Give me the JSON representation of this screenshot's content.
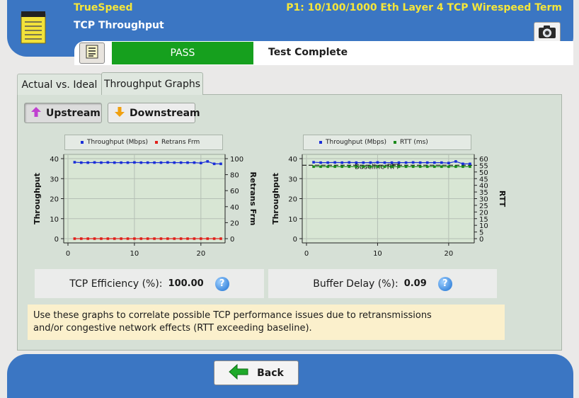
{
  "header": {
    "app_title": "TrueSpeed",
    "port_title": "P1: 10/100/1000 Eth Layer 4 TCP Wirespeed Term",
    "page_title": "TCP Throughput"
  },
  "status": {
    "result": "PASS",
    "result_color": "#16a01e",
    "message": "Test Complete"
  },
  "tabs": [
    {
      "label": "Actual vs. Ideal",
      "active": false
    },
    {
      "label": "Throughput Graphs",
      "active": true
    }
  ],
  "direction_buttons": {
    "upstream": "Upstream",
    "downstream": "Downstream",
    "selected": "upstream"
  },
  "metrics": {
    "tcp_efficiency_label": "TCP Efficiency (%):",
    "tcp_efficiency_value": "100.00",
    "buffer_delay_label": "Buffer Delay (%):",
    "buffer_delay_value": "0.09"
  },
  "note": "Use these graphs to correlate possible TCP performance issues due to retransmissions\nand/or congestive network effects (RTT exceeding baseline).",
  "footer": {
    "back_label": "Back"
  },
  "icons": {
    "app": "notepad-icon",
    "camera": "camera-icon",
    "report": "report-icon",
    "up": "arrow-up-icon",
    "down": "arrow-down-icon",
    "help": "help-icon",
    "back": "arrow-left-icon"
  },
  "colors": {
    "brand_blue": "#3b76c3",
    "header_yellow": "#f5e63a",
    "throughput": "#1a2fd8",
    "retrans": "#e0201a",
    "rtt": "#1a8a1a",
    "panel": "#d6e0d6",
    "note_bg": "#fbf0cc"
  },
  "chart_data": [
    {
      "type": "line",
      "legend": [
        "Throughput (Mbps)",
        "Retrans Frm"
      ],
      "ylabel": "Throughput",
      "y2label": "Retrans Frm",
      "xlim": [
        0,
        23
      ],
      "ylim": [
        0,
        40
      ],
      "y2lim": [
        0,
        100
      ],
      "x_ticks": [
        0,
        10,
        20
      ],
      "y_ticks": [
        0,
        10,
        20,
        30,
        40
      ],
      "y2_ticks": [
        0,
        20,
        40,
        60,
        80,
        100
      ],
      "grid": true,
      "series": [
        {
          "name": "Throughput (Mbps)",
          "axis": "left",
          "color": "#1a2fd8",
          "x": [
            1,
            2,
            3,
            4,
            5,
            6,
            7,
            8,
            9,
            10,
            11,
            12,
            13,
            14,
            15,
            16,
            17,
            18,
            19,
            20,
            21,
            22,
            23
          ],
          "y": [
            38.2,
            38,
            38,
            38.1,
            38,
            38.1,
            38,
            38,
            38,
            38.1,
            38,
            38,
            38,
            38,
            38.1,
            38,
            38,
            38,
            38,
            37.8,
            38.6,
            37.4,
            37.4
          ]
        },
        {
          "name": "Retrans Frm",
          "axis": "right",
          "color": "#e0201a",
          "x": [
            1,
            2,
            3,
            4,
            5,
            6,
            7,
            8,
            9,
            10,
            11,
            12,
            13,
            14,
            15,
            16,
            17,
            18,
            19,
            20,
            21,
            22,
            23
          ],
          "y": [
            0,
            0,
            0,
            0,
            0,
            0,
            0,
            0,
            0,
            0,
            0,
            0,
            0,
            0,
            0,
            0,
            0,
            0,
            0,
            0,
            0,
            0,
            0
          ]
        }
      ]
    },
    {
      "type": "line",
      "legend": [
        "Throughput (Mbps)",
        "RTT (ms)"
      ],
      "ylabel": "Throughput",
      "y2label": "RTT",
      "xlim": [
        0,
        23
      ],
      "ylim": [
        0,
        40
      ],
      "y2lim": [
        0,
        60
      ],
      "x_ticks": [
        0,
        10,
        20
      ],
      "y_ticks": [
        0,
        10,
        20,
        30,
        40
      ],
      "y2_ticks": [
        0,
        5,
        10,
        15,
        20,
        25,
        30,
        35,
        40,
        45,
        50,
        55,
        60
      ],
      "grid": true,
      "annotation": "Baseline RTT",
      "baseline_rtt": 54,
      "series": [
        {
          "name": "Throughput (Mbps)",
          "axis": "left",
          "color": "#1a2fd8",
          "x": [
            1,
            2,
            3,
            4,
            5,
            6,
            7,
            8,
            9,
            10,
            11,
            12,
            13,
            14,
            15,
            16,
            17,
            18,
            19,
            20,
            21,
            22,
            23
          ],
          "y": [
            38.2,
            38,
            38,
            38.1,
            38,
            38.1,
            38,
            38,
            38,
            38.1,
            38,
            38,
            38,
            38,
            38.1,
            38,
            38,
            38,
            38,
            37.8,
            38.6,
            37.4,
            37.4
          ]
        },
        {
          "name": "RTT (ms)",
          "axis": "right",
          "color": "#1a8a1a",
          "x": [
            1,
            2,
            3,
            4,
            5,
            6,
            7,
            8,
            9,
            10,
            11,
            12,
            13,
            14,
            15,
            16,
            17,
            18,
            19,
            20,
            21,
            22,
            23
          ],
          "y": [
            54,
            54,
            54,
            54,
            54,
            54,
            54,
            54,
            54,
            54,
            54,
            54,
            54,
            54,
            54,
            54,
            54,
            54,
            54,
            54,
            54,
            54,
            54
          ]
        }
      ]
    }
  ]
}
